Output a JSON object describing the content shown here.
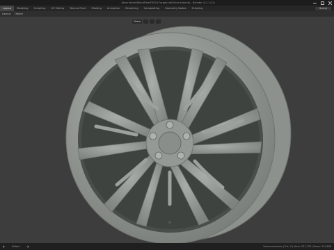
{
  "window": {
    "title": "...\\New folder\\BlendFiles\\FS924 Forged_withScene.blend] - Blender 4.2.1 (\\1)"
  },
  "workspaces": {
    "tabs": [
      "Layout",
      "Modeling",
      "Sculpting",
      "UV Editing",
      "Texture Paint",
      "Shading",
      "Animation",
      "Rendering",
      "Compositing",
      "Geometry Nodes",
      "Scripting"
    ],
    "active": "Layout",
    "scene_label": "Scene"
  },
  "header": {
    "items": [
      "Layout",
      "Object"
    ]
  },
  "viewport": {
    "tool_labels": [
      "Global"
    ]
  },
  "statusbar": {
    "select_label": "Select",
    "stats": "Scene-elements | Tris: 0 | Verts: 231,733 | Faces: 211,808"
  },
  "colors": {
    "background": "#3d3d3d",
    "wheel": "#9da19d",
    "ui_dark": "#1c1c1c"
  },
  "icons": [
    "mouse-left-icon",
    "mouse-middle-icon",
    "minimize-icon",
    "maximize-icon",
    "close-icon"
  ]
}
